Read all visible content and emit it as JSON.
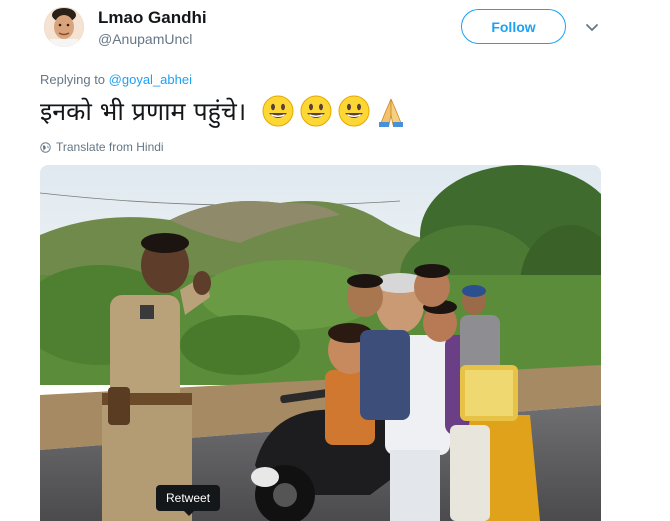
{
  "author": {
    "display_name": "Lmao Gandhi",
    "handle": "@AnupamUncl",
    "avatar_icon": "profile-photo"
  },
  "follow_label": "Follow",
  "reply": {
    "prefix": "Replying to",
    "mention": "@goyal_abhei"
  },
  "tweet": {
    "text": "इनको भी प्रणाम पहुंचे।",
    "emojis": [
      "grinning-face",
      "grinning-face",
      "grinning-face",
      "folded-hands"
    ]
  },
  "translate_label": "Translate from Hindi",
  "tooltip_label": "Retweet",
  "colors": {
    "accent": "#1da1f2",
    "text": "#14171a",
    "muted": "#657786"
  }
}
